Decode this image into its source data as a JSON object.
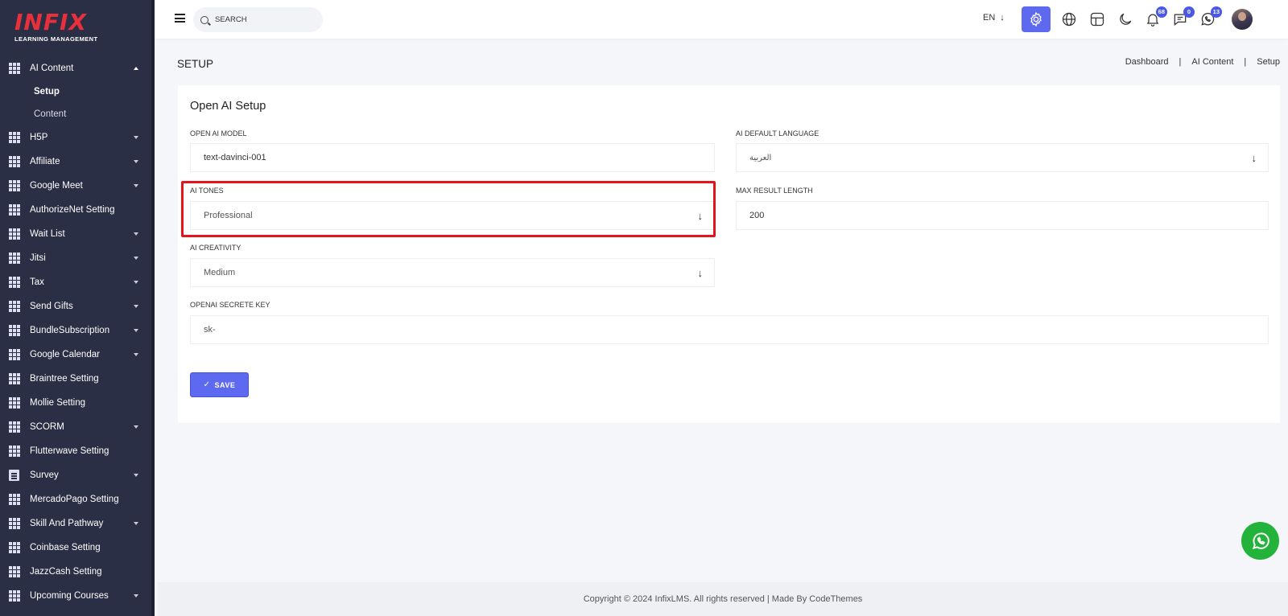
{
  "brand": {
    "logo_text": "INFIX",
    "logo_sub": "LEARNING MANAGEMENT"
  },
  "sidebar": {
    "items": [
      {
        "label": "AI Content",
        "icon": "grid-icon",
        "caret": "up"
      },
      {
        "label": "Setup",
        "sub": true,
        "active": true
      },
      {
        "label": "Content",
        "sub": true
      },
      {
        "label": "H5P",
        "icon": "grid-icon",
        "caret": "down"
      },
      {
        "label": "Affiliate",
        "icon": "grid-icon",
        "caret": "down"
      },
      {
        "label": "Google Meet",
        "icon": "grid-icon",
        "caret": "down"
      },
      {
        "label": "AuthorizeNet Setting",
        "icon": "grid-icon"
      },
      {
        "label": "Wait List",
        "icon": "grid-icon",
        "caret": "down"
      },
      {
        "label": "Jitsi",
        "icon": "grid-icon",
        "caret": "down"
      },
      {
        "label": "Tax",
        "icon": "grid-icon",
        "caret": "down"
      },
      {
        "label": "Send Gifts",
        "icon": "grid-icon",
        "caret": "down"
      },
      {
        "label": "BundleSubscription",
        "icon": "grid-icon",
        "caret": "down"
      },
      {
        "label": "Google Calendar",
        "icon": "grid-icon",
        "caret": "down"
      },
      {
        "label": "Braintree Setting",
        "icon": "grid-icon"
      },
      {
        "label": "Mollie Setting",
        "icon": "grid-icon"
      },
      {
        "label": "SCORM",
        "icon": "grid-icon",
        "caret": "down"
      },
      {
        "label": "Flutterwave Setting",
        "icon": "grid-icon"
      },
      {
        "label": "Survey",
        "icon": "document-icon",
        "caret": "down"
      },
      {
        "label": "MercadoPago Setting",
        "icon": "grid-icon"
      },
      {
        "label": "Skill And Pathway",
        "icon": "grid-icon",
        "caret": "down"
      },
      {
        "label": "Coinbase Setting",
        "icon": "grid-icon"
      },
      {
        "label": "JazzCash Setting",
        "icon": "grid-icon"
      },
      {
        "label": "Upcoming Courses",
        "icon": "grid-icon",
        "caret": "down"
      }
    ]
  },
  "header": {
    "search_placeholder": "SEARCH",
    "language": "EN",
    "notifications_count": "68",
    "messages_count": "0",
    "whatsapp_count": "13"
  },
  "page": {
    "title": "SETUP",
    "breadcrumb": [
      "Dashboard",
      "AI Content",
      "Setup"
    ]
  },
  "form": {
    "title": "Open AI Setup",
    "model_label": "OPEN AI MODEL",
    "model_value": "text-davinci-001",
    "language_label": "AI DEFAULT LANGUAGE",
    "language_value": "العربية",
    "tones_label": "AI TONES",
    "tones_value": "Professional",
    "max_length_label": "MAX RESULT LENGTH",
    "max_length_value": "200",
    "creativity_label": "AI CREATIVITY",
    "creativity_value": "Medium",
    "secret_label": "OPENAI SECRETE KEY",
    "secret_value": "sk-",
    "save_label": "SAVE"
  },
  "footer": {
    "text": "Copyright © 2024 InfixLMS. All rights reserved | Made By CodeThemes"
  },
  "colors": {
    "accent": "#5d6af0",
    "sidebar": "#2b2f45",
    "highlight": "#e3141b",
    "whatsapp": "#23b33a"
  }
}
